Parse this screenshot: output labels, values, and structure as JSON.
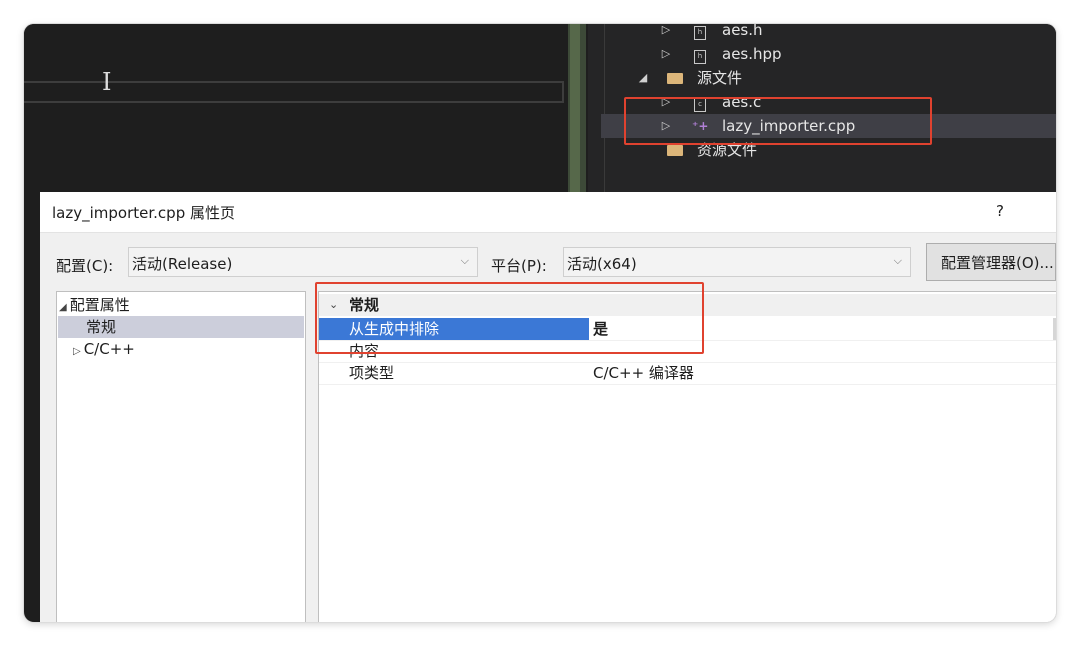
{
  "solution_tree": {
    "items": [
      {
        "label": "aes.h",
        "icon": "header-file-icon",
        "arrow": "▷"
      },
      {
        "label": "aes.hpp",
        "icon": "header-file-icon",
        "arrow": "▷"
      },
      {
        "label": "源文件",
        "icon": "folder-icon",
        "arrow": "◢"
      },
      {
        "label": "aes.c",
        "icon": "c-file-icon",
        "arrow": "▷"
      },
      {
        "label": "lazy_importer.cpp",
        "icon": "cpp-file-icon",
        "arrow": "▷"
      },
      {
        "label": "资源文件",
        "icon": "folder-icon",
        "arrow": ""
      }
    ],
    "icon_glyphs": {
      "h": "h",
      "c": "c",
      "plus": "⁺+"
    }
  },
  "dialog": {
    "title": "lazy_importer.cpp 属性页",
    "help": "?",
    "config_label": "配置(C):",
    "config_value": "活动(Release)",
    "platform_label": "平台(P):",
    "platform_value": "活动(x64)",
    "config_manager_label": "配置管理器(O)...",
    "chevron": "⌵"
  },
  "tree": {
    "root_arrow": "◢",
    "root_label": "配置属性",
    "general_label": "常规",
    "cpp_arrow": "▷",
    "cpp_label": "C/C++"
  },
  "grid": {
    "category_toggle": "⌄",
    "category": "常规",
    "rows": [
      {
        "name": "从生成中排除",
        "value": "是"
      },
      {
        "name": "内容",
        "value": ""
      },
      {
        "name": "项类型",
        "value": "C/C++ 编译器"
      }
    ]
  },
  "editor": {
    "cursor_glyph": "I"
  },
  "colors": {
    "highlight_red": "#e0422f",
    "selection_blue": "#3b78d6",
    "tree_selection": "#cccedb",
    "ide_background": "#1e1e1e"
  }
}
